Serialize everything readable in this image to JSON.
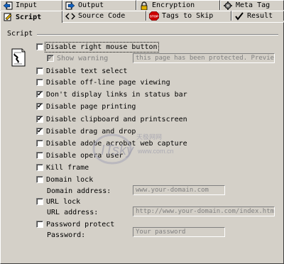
{
  "tabs_row1": [
    {
      "label": "Input",
      "icon": "arrow-left-icon"
    },
    {
      "label": "Output",
      "icon": "arrow-right-icon"
    },
    {
      "label": "Encryption",
      "icon": "lock-icon"
    },
    {
      "label": "Meta Tag",
      "icon": "gear-icon"
    }
  ],
  "tabs_row2": [
    {
      "label": "Script",
      "icon": "pencil-icon",
      "active": true
    },
    {
      "label": "Source Code",
      "icon": "code-icon"
    },
    {
      "label": "Tags to Skip",
      "icon": "stop-icon",
      "icon_text": "STOP"
    },
    {
      "label": "Result",
      "icon": "check-icon"
    }
  ],
  "group": {
    "label": "Script"
  },
  "options": {
    "disable_right_click": {
      "label": "Disable right mouse button",
      "checked": false
    },
    "show_warning": {
      "label": "Show warning",
      "checked": true,
      "disabled": true
    },
    "warning_text": "this page has been protected. Preview",
    "disable_text_select": {
      "label": "Disable text select",
      "checked": false
    },
    "disable_offline": {
      "label": "Disable off-line page viewing",
      "checked": false
    },
    "no_status_links": {
      "label": "Don't display links in status bar",
      "checked": true
    },
    "disable_printing": {
      "label": "Disable page printing",
      "checked": true
    },
    "disable_clipboard": {
      "label": "Disable clipboard and printscreen",
      "checked": true
    },
    "disable_drag": {
      "label": "Disable drag and drop",
      "checked": true
    },
    "disable_acrobat": {
      "label": "Disable adobe acrobat web capture",
      "checked": false
    },
    "disable_opera": {
      "label": "Disable opera user",
      "checked": false
    },
    "kill_frame": {
      "label": "Kill frame",
      "checked": false
    },
    "domain_lock": {
      "label": "Domain lock",
      "checked": false
    },
    "domain_address_label": "Domain address:",
    "domain_address_placeholder": "www.your-domain.com",
    "url_lock": {
      "label": "URL lock",
      "checked": false
    },
    "url_address_label": "URL address:",
    "url_address_placeholder": "http://www.your-domain.com/index.htm",
    "password_protect": {
      "label": "Password protect",
      "checked": false
    },
    "password_label": "Password:",
    "password_placeholder": "Your password"
  },
  "watermark": {
    "text1": "ITsky",
    "text2": "天极网网",
    "text3": "www.com.cn"
  },
  "colors": {
    "face": "#d4d0c8",
    "shadow": "#808080",
    "stop": "#cc0000"
  }
}
